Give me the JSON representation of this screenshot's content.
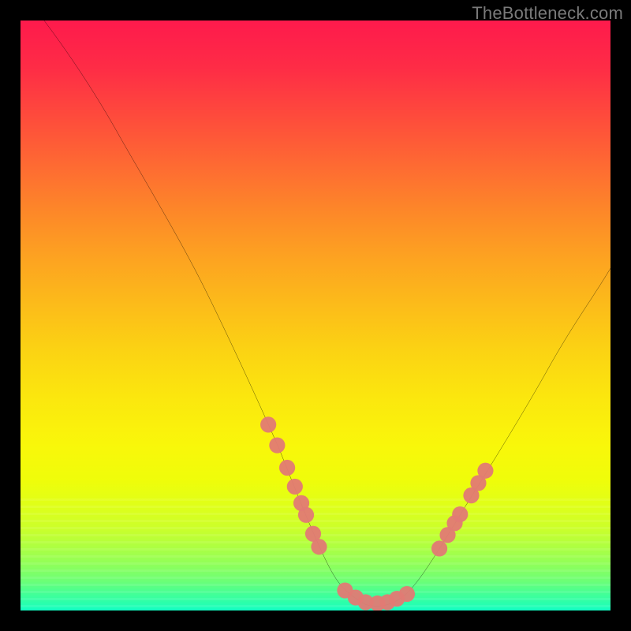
{
  "watermark": "TheBottleneck.com",
  "chart_data": {
    "type": "line",
    "title": "",
    "xlabel": "",
    "ylabel": "",
    "xlim": [
      0,
      100
    ],
    "ylim": [
      0,
      100
    ],
    "grid": false,
    "series": [
      {
        "name": "bottleneck-curve",
        "x": [
          4,
          10,
          17,
          24,
          31,
          38,
          44,
          48,
          52,
          55.5,
          58.5,
          62,
          65,
          69,
          75,
          82,
          90,
          100
        ],
        "y": [
          100,
          91,
          80,
          68,
          55,
          41,
          27,
          17,
          8,
          3,
          1,
          1,
          2.5,
          7,
          17,
          29,
          42,
          58
        ]
      }
    ],
    "markers": [
      {
        "name": "left-arm-dots",
        "color": "#e57373",
        "points": [
          {
            "x": 42.0,
            "y": 31.5
          },
          {
            "x": 43.5,
            "y": 28.0
          },
          {
            "x": 45.2,
            "y": 24.2
          },
          {
            "x": 46.5,
            "y": 21.0
          },
          {
            "x": 47.6,
            "y": 18.2
          },
          {
            "x": 48.4,
            "y": 16.2
          },
          {
            "x": 49.6,
            "y": 13.0
          },
          {
            "x": 50.6,
            "y": 10.8
          }
        ]
      },
      {
        "name": "valley-dots",
        "color": "#e57373",
        "points": [
          {
            "x": 55.0,
            "y": 3.4
          },
          {
            "x": 56.8,
            "y": 2.2
          },
          {
            "x": 58.5,
            "y": 1.4
          },
          {
            "x": 60.5,
            "y": 1.2
          },
          {
            "x": 62.2,
            "y": 1.4
          },
          {
            "x": 63.8,
            "y": 2.0
          },
          {
            "x": 65.5,
            "y": 2.8
          }
        ]
      },
      {
        "name": "right-arm-dots",
        "color": "#e57373",
        "points": [
          {
            "x": 71.0,
            "y": 10.5
          },
          {
            "x": 72.4,
            "y": 12.8
          },
          {
            "x": 73.6,
            "y": 14.8
          },
          {
            "x": 74.5,
            "y": 16.3
          },
          {
            "x": 76.4,
            "y": 19.5
          },
          {
            "x": 77.6,
            "y": 21.6
          },
          {
            "x": 78.8,
            "y": 23.7
          }
        ]
      }
    ],
    "background_gradient_stops": [
      {
        "pos": 0.0,
        "hex": "#fe1a4c"
      },
      {
        "pos": 0.5,
        "hex": "#fcc516"
      },
      {
        "pos": 0.8,
        "hex": "#e9fe0c"
      },
      {
        "pos": 1.0,
        "hex": "#11ffc4"
      }
    ]
  }
}
